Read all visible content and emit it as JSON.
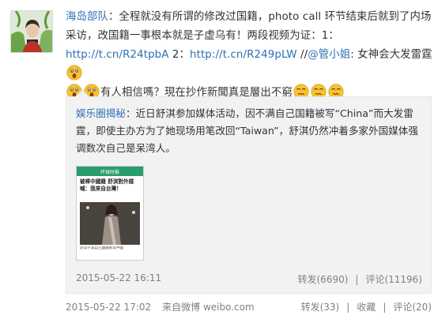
{
  "post": {
    "author": "海岛部队",
    "text_part1": "：全程就没有所谓的修改过国籍，photo call 环节结束后就到了内场采访，改国籍一事根本就是子虚乌有！两段视频为证：1：",
    "link1": "http://t.cn/R24tpbA",
    "text_part2": " 2：",
    "link2": "http://t.cn/R249pLW",
    "text_part3": " //",
    "mention": "@管小姐",
    "text_part4": ": 女神会大发雷霆",
    "text_part5": "有人相信嗎？現在抄作新聞真是層出不窮",
    "time": "2015-05-22 17:02",
    "source": "来自微博 weibo.com",
    "actions": {
      "repost": "转发(33)",
      "favorite": "收藏",
      "comment": "评论(20)"
    }
  },
  "retweet": {
    "author": "娱乐圈揭秘",
    "text": "：近日舒淇参加媒体活动，因不满自己国籍被写“China”而大发雷霆，即使主办方为了她现场用笔改回“Taiwan”，舒淇仍然冲着多家外国媒体强调数次自己是呆湾人。",
    "thumb": {
      "header": "环球时报",
      "headline": "被棒中國籍 舒淇對外媒喊：我來自台灣！",
      "caption": "舒淇不滿自己國籍被寫中國"
    },
    "time": "2015-05-22 16:11",
    "actions": {
      "repost": "转发(6690)",
      "comment": "评论(11196)"
    }
  },
  "colors": {
    "link": "#2d6fb4",
    "text": "#333333",
    "muted": "#808080",
    "retweet_bg": "#f2f2f2",
    "emoji_face": "#f7c331"
  },
  "icons": {
    "surprised": "surprised-face-icon",
    "dizzy": "dizzy-face-icon"
  }
}
